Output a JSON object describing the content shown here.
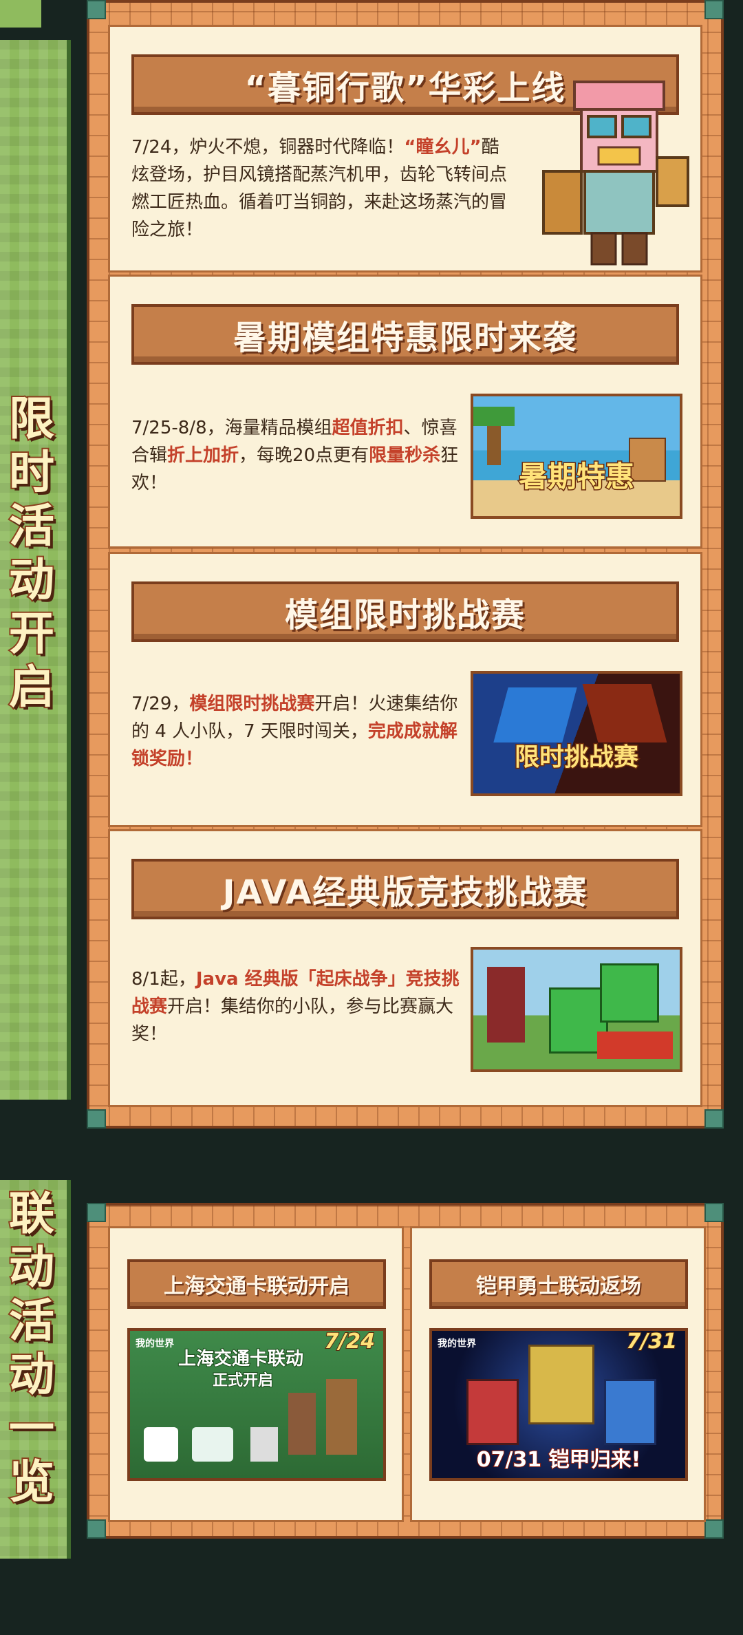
{
  "sidebar": {
    "limited_label": [
      "限",
      "时",
      "活",
      "动",
      "开",
      "启"
    ],
    "collab_label": [
      "联",
      "动",
      "活",
      "动",
      "一",
      "览"
    ]
  },
  "limited_events": [
    {
      "title": "“暮铜行歌”华彩上线",
      "desc_parts": [
        {
          "text": "7/24，炉火不熄，铜器时代降临！",
          "hl": false
        },
        {
          "text": "“瞳幺儿”",
          "hl": true
        },
        {
          "text": "酷炫登场，护目风镜搭配蒸汽机甲，齿轮飞转间点燃工匠热血。循着叮当铜韵，来赴这场蒸汽的冒险之旅！",
          "hl": false
        }
      ]
    },
    {
      "title": "暑期模组特惠限时来袭",
      "desc_parts": [
        {
          "text": "7/25-8/8，海量精品模组",
          "hl": false
        },
        {
          "text": "超值折扣",
          "hl": true
        },
        {
          "text": "、惊喜合辑",
          "hl": false
        },
        {
          "text": "折上加折",
          "hl": true
        },
        {
          "text": "，每晚20点更有",
          "hl": false
        },
        {
          "text": "限量秒杀",
          "hl": true
        },
        {
          "text": "狂欢！",
          "hl": false
        }
      ],
      "thumb_label": "暑期特惠"
    },
    {
      "title": "模组限时挑战赛",
      "desc_parts": [
        {
          "text": "7/29，",
          "hl": false
        },
        {
          "text": "模组限时挑战赛",
          "hl": true
        },
        {
          "text": "开启！火速集结你的 4 人小队，7 天限时闯关，",
          "hl": false
        },
        {
          "text": "完成成就解锁奖励！",
          "hl": true
        }
      ],
      "thumb_label": "限时挑战赛"
    },
    {
      "title": "JAVA经典版竞技挑战赛",
      "desc_parts": [
        {
          "text": "8/1起，",
          "hl": false
        },
        {
          "text": "Java 经典版「起床战争」竞技挑战赛",
          "hl": true
        },
        {
          "text": "开启！集结你的小队，参与比赛赢大奖！",
          "hl": false
        }
      ]
    }
  ],
  "collab_events": [
    {
      "title": "上海交通卡联动开启",
      "image_head": "上海交通卡联动",
      "image_sub": "正式开启",
      "image_date": "7/24",
      "image_brand": "我的世界"
    },
    {
      "title": "铠甲勇士联动返场",
      "image_date": "7/31",
      "image_bottom": "07/31 铠甲归来!",
      "image_brand": "我的世界"
    }
  ],
  "colors": {
    "accent_red": "#c4412a",
    "panel_orange": "#e79a5e",
    "side_green": "#8fbb5e",
    "background": "#172420"
  }
}
